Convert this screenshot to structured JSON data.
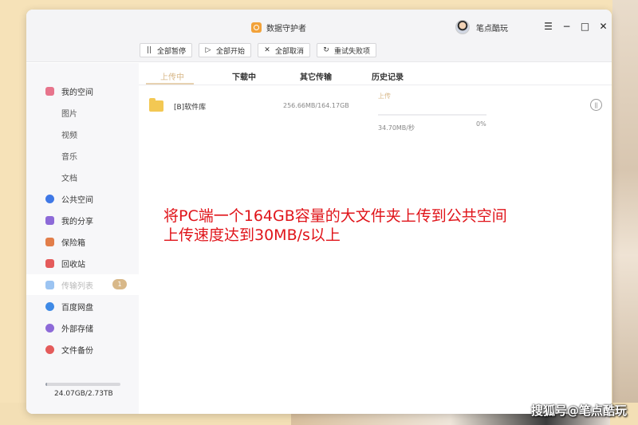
{
  "app": {
    "title": "数据守护者",
    "user_name": "笔点酷玩",
    "window_controls": [
      "☰",
      "−",
      "□",
      "✕"
    ],
    "accent_color": "#d8b889"
  },
  "toolbar": {
    "buttons": [
      {
        "icon": "pause-icon",
        "glyph": "||",
        "label": "全部暂停"
      },
      {
        "icon": "play-icon",
        "glyph": "▷",
        "label": "全部开始"
      },
      {
        "icon": "close-icon",
        "glyph": "✕",
        "label": "全部取消"
      },
      {
        "icon": "retry-icon",
        "glyph": "↻",
        "label": "重试失败项"
      }
    ]
  },
  "sidebar": {
    "items": [
      {
        "label": "我的空间",
        "icon": "my-space-icon",
        "color": "#e7748c"
      },
      {
        "label": "图片",
        "sub": true
      },
      {
        "label": "视频",
        "sub": true
      },
      {
        "label": "音乐",
        "sub": true
      },
      {
        "label": "文档",
        "sub": true
      },
      {
        "label": "公共空间",
        "icon": "public-space-icon",
        "color": "#3f78e6"
      },
      {
        "label": "我的分享",
        "icon": "share-icon",
        "color": "#8d6ad8"
      },
      {
        "label": "保险箱",
        "icon": "safe-icon",
        "color": "#e27e4a"
      },
      {
        "label": "回收站",
        "icon": "recycle-bin-icon",
        "color": "#e45b5b"
      },
      {
        "label": "传输列表",
        "icon": "transfer-icon",
        "color": "#6aa7f0",
        "active": true,
        "badge": "1"
      },
      {
        "label": "百度网盘",
        "icon": "baidu-netdisk-icon",
        "color": "#3f8ae6"
      },
      {
        "label": "外部存储",
        "icon": "external-storage-icon",
        "color": "#8d6ad8"
      },
      {
        "label": "文件备份",
        "icon": "backup-icon",
        "color": "#e45b5b"
      }
    ],
    "storage": {
      "text": "24.07GB/2.73TB",
      "used_fraction": 0.0086
    }
  },
  "tabs": [
    "上传中",
    "下载中",
    "其它传输",
    "历史记录"
  ],
  "transfers": [
    {
      "name": "[B]软件库",
      "size": "256.66MB/164.17GB",
      "status": "上传",
      "speed": "34.70MB/秒",
      "percent": "0%",
      "progress_fraction": 0.0
    }
  ],
  "overlay": {
    "line1": "将PC端一个164GB容量的大文件夹上传到公共空间",
    "line2": "上传速度达到30MB/s以上"
  },
  "watermark": "搜狐号@笔点酷玩"
}
